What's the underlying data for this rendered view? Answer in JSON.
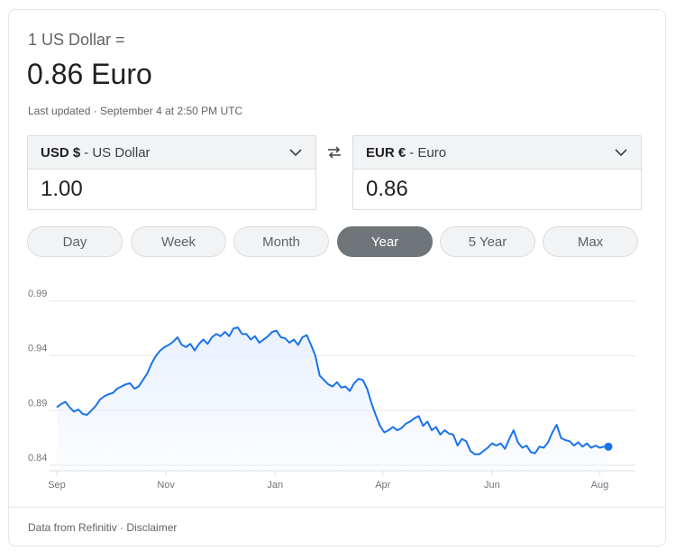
{
  "header": {
    "equation": "1 US Dollar =",
    "result": "0.86 Euro",
    "last_updated": "Last updated · September 4 at 2:50 PM UTC"
  },
  "from_currency": {
    "code": "USD $",
    "name": "- US Dollar",
    "value": "1.00"
  },
  "to_currency": {
    "code": "EUR €",
    "name": "- Euro",
    "value": "0.86"
  },
  "ranges": [
    "Day",
    "Week",
    "Month",
    "Year",
    "5 Year",
    "Max"
  ],
  "selected_range": "Year",
  "footer": {
    "source": "Data from Refinitiv",
    "separator": " · ",
    "disclaimer": "Disclaimer"
  },
  "colors": {
    "line": "#1a73e8",
    "fill_top": "#e8f0fe",
    "active_pill": "#70757a"
  },
  "chart_data": {
    "type": "area",
    "ylim": [
      0.835,
      0.99
    ],
    "y_ticks": [
      "0.99",
      "0.94",
      "0.89",
      "0.84"
    ],
    "y_tick_values": [
      0.99,
      0.94,
      0.89,
      0.84
    ],
    "x_ticks": [
      "Sep",
      "Nov",
      "Jan",
      "Apr",
      "Jun",
      "Aug"
    ],
    "x_tick_index": [
      0,
      60,
      120,
      180,
      240,
      300
    ],
    "x_count": 311,
    "values": [
      [
        0,
        0.893
      ],
      [
        3,
        0.896
      ],
      [
        6,
        0.898
      ],
      [
        9,
        0.893
      ],
      [
        12,
        0.889
      ],
      [
        15,
        0.891
      ],
      [
        18,
        0.887
      ],
      [
        21,
        0.886
      ],
      [
        24,
        0.89
      ],
      [
        27,
        0.894
      ],
      [
        30,
        0.9
      ],
      [
        33,
        0.903
      ],
      [
        36,
        0.905
      ],
      [
        39,
        0.906
      ],
      [
        42,
        0.91
      ],
      [
        45,
        0.912
      ],
      [
        48,
        0.914
      ],
      [
        51,
        0.915
      ],
      [
        54,
        0.91
      ],
      [
        57,
        0.912
      ],
      [
        60,
        0.918
      ],
      [
        63,
        0.924
      ],
      [
        66,
        0.933
      ],
      [
        69,
        0.94
      ],
      [
        72,
        0.945
      ],
      [
        75,
        0.948
      ],
      [
        78,
        0.95
      ],
      [
        81,
        0.953
      ],
      [
        84,
        0.957
      ],
      [
        87,
        0.95
      ],
      [
        90,
        0.948
      ],
      [
        93,
        0.951
      ],
      [
        96,
        0.945
      ],
      [
        99,
        0.951
      ],
      [
        102,
        0.955
      ],
      [
        105,
        0.951
      ],
      [
        108,
        0.957
      ],
      [
        111,
        0.96
      ],
      [
        114,
        0.958
      ],
      [
        117,
        0.962
      ],
      [
        120,
        0.958
      ],
      [
        123,
        0.965
      ],
      [
        126,
        0.966
      ],
      [
        129,
        0.96
      ],
      [
        132,
        0.96
      ],
      [
        135,
        0.955
      ],
      [
        138,
        0.958
      ],
      [
        141,
        0.952
      ],
      [
        144,
        0.955
      ],
      [
        147,
        0.958
      ],
      [
        150,
        0.962
      ],
      [
        153,
        0.963
      ],
      [
        156,
        0.957
      ],
      [
        159,
        0.956
      ],
      [
        162,
        0.952
      ],
      [
        165,
        0.955
      ],
      [
        168,
        0.95
      ],
      [
        171,
        0.957
      ],
      [
        174,
        0.959
      ],
      [
        177,
        0.95
      ],
      [
        180,
        0.94
      ],
      [
        183,
        0.922
      ],
      [
        186,
        0.918
      ],
      [
        189,
        0.914
      ],
      [
        192,
        0.912
      ],
      [
        195,
        0.916
      ],
      [
        198,
        0.911
      ],
      [
        201,
        0.912
      ],
      [
        204,
        0.908
      ],
      [
        207,
        0.915
      ],
      [
        210,
        0.919
      ],
      [
        213,
        0.918
      ],
      [
        216,
        0.91
      ],
      [
        219,
        0.897
      ],
      [
        222,
        0.886
      ],
      [
        225,
        0.876
      ],
      [
        228,
        0.87
      ],
      [
        231,
        0.872
      ],
      [
        234,
        0.875
      ],
      [
        237,
        0.872
      ],
      [
        240,
        0.874
      ],
      [
        243,
        0.878
      ],
      [
        246,
        0.88
      ],
      [
        249,
        0.883
      ],
      [
        252,
        0.885
      ],
      [
        255,
        0.876
      ],
      [
        258,
        0.88
      ],
      [
        261,
        0.872
      ],
      [
        264,
        0.875
      ],
      [
        267,
        0.868
      ],
      [
        270,
        0.872
      ],
      [
        273,
        0.869
      ],
      [
        276,
        0.868
      ],
      [
        279,
        0.858
      ],
      [
        282,
        0.864
      ],
      [
        285,
        0.862
      ],
      [
        288,
        0.853
      ],
      [
        291,
        0.85
      ],
      [
        294,
        0.85
      ],
      [
        297,
        0.853
      ],
      [
        300,
        0.856
      ],
      [
        303,
        0.86
      ],
      [
        306,
        0.858
      ],
      [
        309,
        0.86
      ],
      [
        312,
        0.855
      ],
      [
        315,
        0.864
      ],
      [
        318,
        0.872
      ],
      [
        321,
        0.861
      ],
      [
        324,
        0.856
      ],
      [
        327,
        0.858
      ],
      [
        330,
        0.852
      ],
      [
        333,
        0.851
      ],
      [
        336,
        0.857
      ],
      [
        339,
        0.856
      ],
      [
        342,
        0.861
      ],
      [
        345,
        0.87
      ],
      [
        348,
        0.877
      ],
      [
        351,
        0.865
      ],
      [
        354,
        0.863
      ],
      [
        357,
        0.862
      ],
      [
        360,
        0.858
      ],
      [
        363,
        0.861
      ],
      [
        366,
        0.857
      ],
      [
        369,
        0.86
      ],
      [
        372,
        0.856
      ],
      [
        375,
        0.858
      ],
      [
        378,
        0.856
      ],
      [
        381,
        0.857
      ],
      [
        384,
        0.857
      ]
    ]
  }
}
